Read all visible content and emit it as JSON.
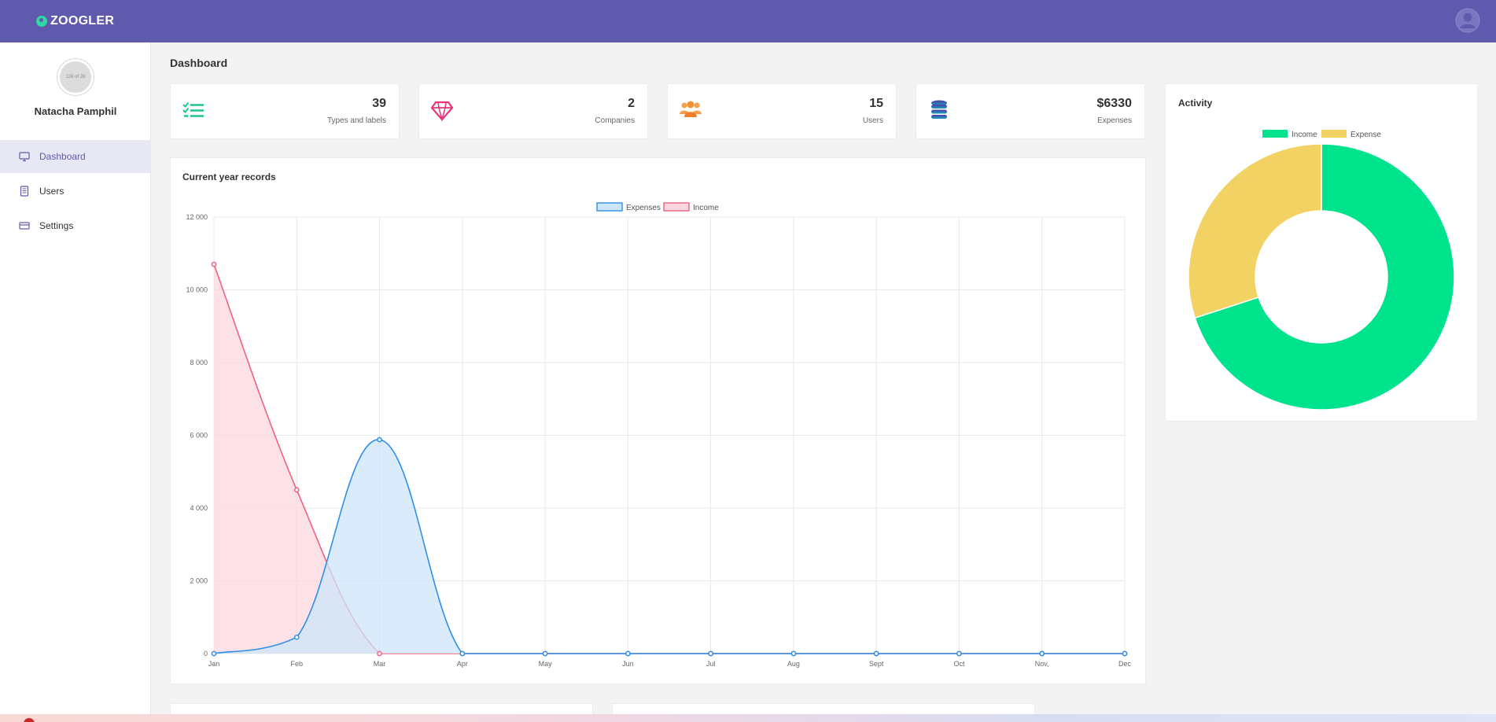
{
  "app": {
    "name": "ZOOGLER"
  },
  "icons": {
    "logo": "logo-dot-icon",
    "user_account": "user-circle-icon",
    "dashboard": "monitor-icon",
    "users": "document-icon",
    "settings": "credit-card-icon",
    "types": "checklist-icon",
    "companies": "diamond-icon",
    "users_stat": "users-group-icon",
    "expenses": "database-icon"
  },
  "colors": {
    "topbar": "#5f5aad",
    "accent": "#5f5aad",
    "income_line": "#f06080",
    "expenses_line": "#2d8fe8",
    "donut_income": "#00e38d",
    "donut_expense": "#f3d264"
  },
  "sidebar": {
    "profile": {
      "avatar_alt": "126 of 28",
      "name": "Natacha Pamphil"
    },
    "items": [
      {
        "label": "Dashboard",
        "icon": "monitor-icon",
        "active": true
      },
      {
        "label": "Users",
        "icon": "document-icon",
        "active": false
      },
      {
        "label": "Settings",
        "icon": "credit-card-icon",
        "active": false
      }
    ]
  },
  "page": {
    "title": "Dashboard"
  },
  "stats": [
    {
      "value": "39",
      "label": "Types and labels",
      "icon": "checklist-icon"
    },
    {
      "value": "2",
      "label": "Companies",
      "icon": "diamond-icon"
    },
    {
      "value": "15",
      "label": "Users",
      "icon": "users-group-icon"
    },
    {
      "value": "$6330",
      "label": "Expenses",
      "icon": "database-icon"
    }
  ],
  "records_card": {
    "title": "Current year records"
  },
  "activity_card": {
    "title": "Activity"
  },
  "chart_data": [
    {
      "type": "line",
      "title": "Current year records",
      "x": [
        "Jan",
        "Feb",
        "Mar",
        "Apr",
        "May",
        "Jun",
        "Jul",
        "Aug",
        "Sept",
        "Oct",
        "Nov,",
        "Dec"
      ],
      "series": [
        {
          "name": "Expenses",
          "values": [
            0,
            450,
            5880,
            0,
            0,
            0,
            0,
            0,
            0,
            0,
            0,
            0
          ],
          "color": "#2d8fe8",
          "fill": "#cde5fa"
        },
        {
          "name": "Income",
          "values": [
            10700,
            4500,
            0,
            0,
            0,
            0,
            0,
            0,
            0,
            0,
            0,
            0
          ],
          "color": "#f06080",
          "fill": "#fbd7df"
        }
      ],
      "ylim": [
        0,
        12000
      ],
      "yticks": [
        "0",
        "2 000",
        "4 000",
        "6 000",
        "8 000",
        "10 000",
        "12 000"
      ],
      "legend": "top-center",
      "grid": true
    },
    {
      "type": "pie",
      "title": "Activity",
      "categories": [
        "Income",
        "Expense"
      ],
      "values": [
        70,
        30
      ],
      "colors": [
        "#00e38d",
        "#f3d264"
      ],
      "donut": true,
      "legend": "top-center"
    }
  ]
}
